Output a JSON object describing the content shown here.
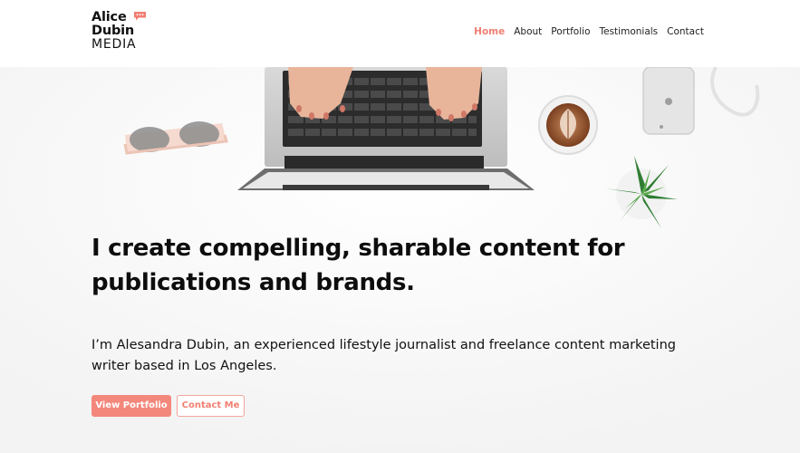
{
  "brand": {
    "line1": "Alice",
    "line2": "Dubin",
    "line3": "MEDIA",
    "accent_color": "#f07f72",
    "bubble_icon": "speech-bubble-icon"
  },
  "nav": {
    "items": [
      {
        "label": "Home",
        "active": true
      },
      {
        "label": "About",
        "active": false
      },
      {
        "label": "Portfolio",
        "active": false
      },
      {
        "label": "Testimonials",
        "active": false
      },
      {
        "label": "Contact",
        "active": false
      }
    ]
  },
  "hero": {
    "headline": "I create compelling, sharable content for publications and brands.",
    "subtext": "I’m Alesandra Dubin, an experienced lifestyle journalist and freelance content marketing writer based in Los Angeles.",
    "primary_button": "View Portfolio",
    "secondary_button": "Contact Me"
  },
  "colors": {
    "button_primary": "#f3877b",
    "button_secondary_border": "#f3a59c",
    "text": "#111111"
  }
}
